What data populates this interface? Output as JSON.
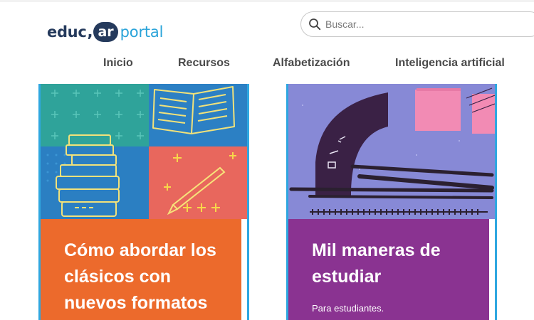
{
  "header": {
    "logo": {
      "part1": "educ",
      "comma": ",",
      "badge": "ar",
      "part2": "portal"
    },
    "search": {
      "placeholder": "Buscar...",
      "icon": "search-icon"
    }
  },
  "nav": {
    "items": [
      {
        "label": "Inicio"
      },
      {
        "label": "Recursos"
      },
      {
        "label": "Alfabetización"
      },
      {
        "label": "Inteligencia artificial"
      }
    ]
  },
  "cards": [
    {
      "title": "Cómo abordar los clásicos con nuevos formatos",
      "subtitle": "",
      "accent": "#ec6a2c"
    },
    {
      "title": "Mil maneras de estudiar",
      "subtitle": "Para estudiantes.",
      "accent": "#8a3391"
    }
  ],
  "colors": {
    "brand_dark": "#253a5c",
    "brand_light": "#29a3d9",
    "card_border": "#2fa7e0"
  }
}
